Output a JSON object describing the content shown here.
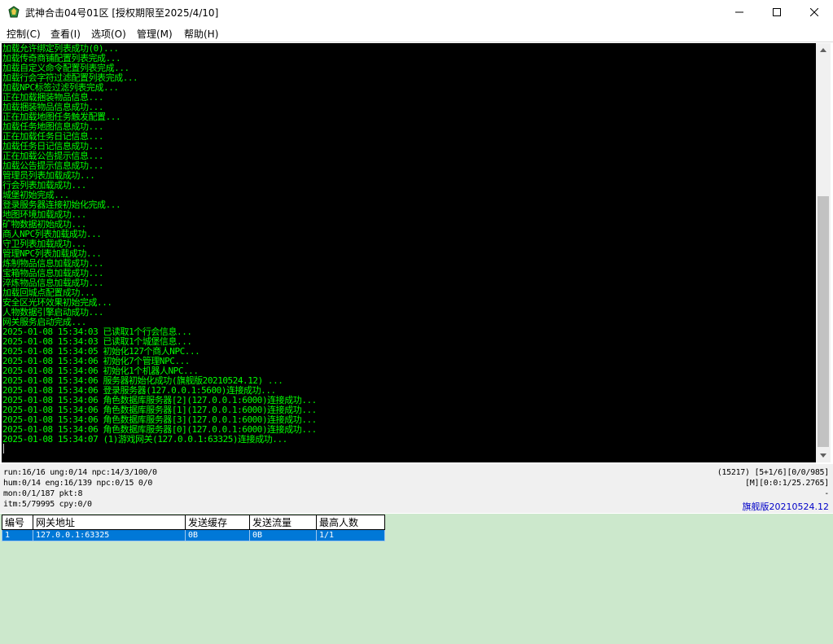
{
  "window": {
    "title": "武神合击04号01区 [授权期限至2025/4/10]",
    "minimize_glyph": "—",
    "maximize_glyph": "☐",
    "close_glyph": "✕",
    "icon": "game-app-icon"
  },
  "menu": [
    "控制(C)",
    "查看(I)",
    "选项(O)",
    "管理(M)",
    "帮助(H)"
  ],
  "log": [
    "加载允许绑定列表成功(0)...",
    "加载传奇商铺配置列表完成...",
    "加载自定义命令配置列表完成...",
    "加载行会字符过滤配置列表完成...",
    "加载NPC标签过滤列表完成...",
    "正在加载捆装物品信息...",
    "加载捆装物品信息成功...",
    "正在加载地图任务触发配置...",
    "加载任务地图信息成功...",
    "正在加载任务日记信息...",
    "加载任务日记信息成功...",
    "正在加载公告提示信息...",
    "加载公告提示信息成功...",
    "管理员列表加载成功...",
    "行会列表加载成功...",
    "城堡初始完成...",
    "登录服务器连接初始化完成...",
    "地图环境加载成功...",
    "矿物数据初始成功...",
    "商人NPC列表加载成功...",
    "守卫列表加载成功...",
    "管理NPC列表加载成功...",
    "炼制物品信息加载成功...",
    "宝箱物品信息加载成功...",
    "淬炼物品信息加载成功...",
    "加载回城点配置成功...",
    "安全区光环效果初始完成...",
    "人物数据引擎启动成功...",
    "网关服务启动完成...",
    "2025-01-08 15:34:03 已读取1个行会信息...",
    "2025-01-08 15:34:03 已读取1个城堡信息...",
    "2025-01-08 15:34:05 初始化127个商人NPC...",
    "2025-01-08 15:34:06 初始化7个管理NPC...",
    "2025-01-08 15:34:06 初始化1个机器人NPC...",
    "2025-01-08 15:34:06 服务器初始化成功(旗舰版20210524.12) ...",
    "2025-01-08 15:34:06 登录服务器(127.0.0.1:5600)连接成功...",
    "2025-01-08 15:34:06 角色数据库服务器[2](127.0.0.1:6000)连接成功...",
    "2025-01-08 15:34:06 角色数据库服务器[1](127.0.0.1:6000)连接成功...",
    "2025-01-08 15:34:06 角色数据库服务器[3](127.0.0.1:6000)连接成功...",
    "2025-01-08 15:34:06 角色数据库服务器[0](127.0.0.1:6000)连接成功...",
    "2025-01-08 15:34:07 (1)游戏网关(127.0.0.1:63325)连接成功..."
  ],
  "status": {
    "left": [
      "run:16/16 ung:0/14 npc:14/3/100/0",
      "hum:0/14 eng:16/139 npc:0/15 0/0",
      "mon:0/1/187 pkt:8",
      "itm:5/79995 cpy:0/0"
    ],
    "right": [
      "(15217) [5+1/6][0/0/985]",
      "[M][0:0:1/25.2765]",
      "-"
    ],
    "edition": "旗舰版20210524.12"
  },
  "gateways": {
    "columns": [
      "编号",
      "网关地址",
      "发送缓存",
      "发送流量",
      "最高人数"
    ],
    "rows": [
      [
        "1",
        "127.0.0.1:63325",
        "0B",
        "0B",
        "1/1"
      ]
    ]
  },
  "colors": {
    "console_bg": "#000000",
    "console_text": "#00ff00",
    "selection": "#0078d7",
    "panel_bg": "#cce8cc",
    "edition_text": "#0000c8"
  }
}
